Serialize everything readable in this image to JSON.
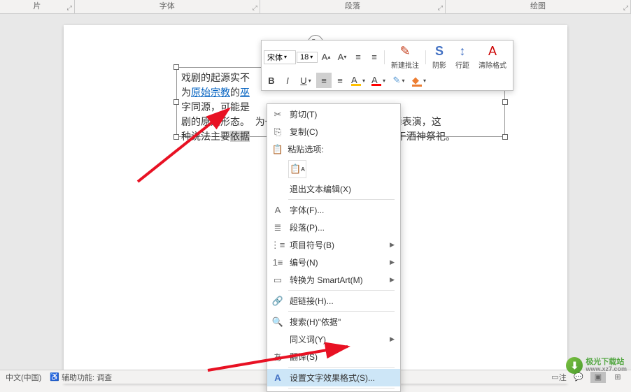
{
  "ribbon": {
    "group_pic": "片",
    "group_font": "字体",
    "group_paragraph": "段落",
    "group_drawing": "绘图"
  },
  "textbox": {
    "line1_a": "戏剧的起源实不",
    "line2_a": "为",
    "line2_link1": "原始宗教",
    "line2_b": "的",
    "line2_link2": "巫",
    "line3_a": "字同源，可能是",
    "line4_a": "剧的原始形态。",
    "line4_b": "为一为劳动庆祝丰收时的即兴歌舞表演，这",
    "line5_a": "种说法主要",
    "line5_hl": "依据",
    "line5_b": "最起源于酒神祭祀。"
  },
  "mini_toolbar": {
    "font_name": "宋体",
    "font_size": "18",
    "btn_bold": "B",
    "btn_italic": "I",
    "btn_underline": "U",
    "btn_increase": "A",
    "btn_decrease": "A",
    "new_comment": "新建批注",
    "shadow": "阴影",
    "line_spacing": "行距",
    "clear_format": "清除格式",
    "letter_a": "A"
  },
  "context_menu": {
    "cut": "剪切(T)",
    "copy": "复制(C)",
    "paste_options": "粘贴选项:",
    "exit_text_edit": "退出文本编辑(X)",
    "font": "字体(F)...",
    "paragraph": "段落(P)...",
    "bullets": "项目符号(B)",
    "numbering": "编号(N)",
    "convert_smartart": "转换为 SmartArt(M)",
    "hyperlink": "超链接(H)...",
    "search_prefix": "搜索(H)\"",
    "search_term": "依据",
    "search_suffix": "\"",
    "synonyms": "同义词(Y)",
    "translate": "翻译(S)",
    "text_effects": "设置文字效果格式(S)..."
  },
  "status": {
    "lang": "中文(中国)",
    "accessibility": "辅助功能: 调查",
    "notes": "注"
  },
  "watermark": {
    "name": "极光下载站",
    "url": "www.xz7.com"
  }
}
